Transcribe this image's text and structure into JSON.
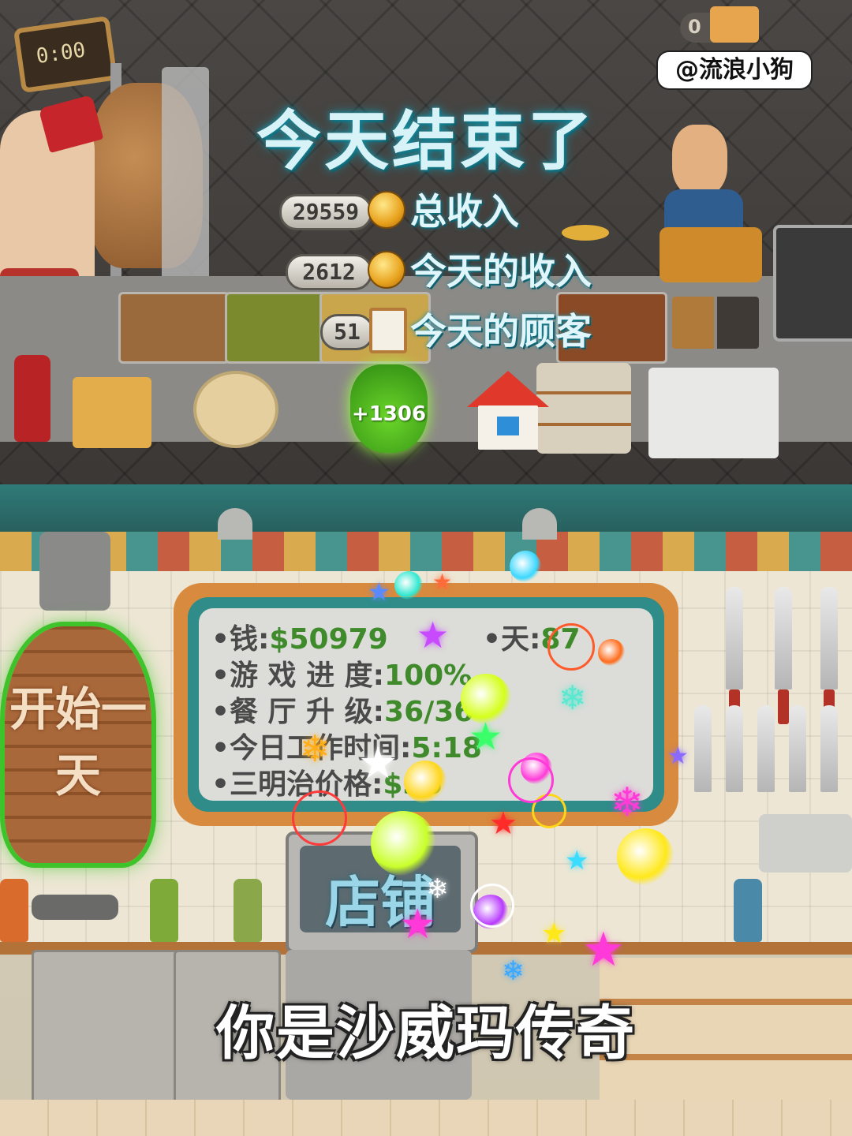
{
  "watermark": "@流浪小狗",
  "top_panel": {
    "clock_text": "0:00",
    "top_counter": "0",
    "title": "今天结束了",
    "stats": [
      {
        "value": "29559",
        "label": "总收入",
        "icon": "coin-icon"
      },
      {
        "value": "2612",
        "label": "今天的收入",
        "icon": "coin-icon"
      },
      {
        "value": "51",
        "label": "今天的顾客",
        "icon": "clipboard-icon"
      }
    ],
    "bonus_label": "+1306",
    "home_icon": "home-icon"
  },
  "bottom_panel": {
    "board": {
      "money_label": "•钱:",
      "money_value": "$50979",
      "day_label": "•天:",
      "day_value": "87",
      "progress_label": "•游 戏 进 度:",
      "progress_value": "100%",
      "upgrade_label": "•餐 厅 升 级:",
      "upgrade_value": "36/36",
      "worktime_label": "•今日工作时间:",
      "worktime_value": "5:18",
      "price_label": "•三明治价格:",
      "price_value": "$36"
    },
    "start_day_label": "开始一天",
    "shop_label": "店铺",
    "caption": "你是沙威玛传奇"
  },
  "colors": {
    "title_glow": "#1b8ea0",
    "highlight_green": "#3ec42a",
    "accent_red": "#e0382b"
  }
}
